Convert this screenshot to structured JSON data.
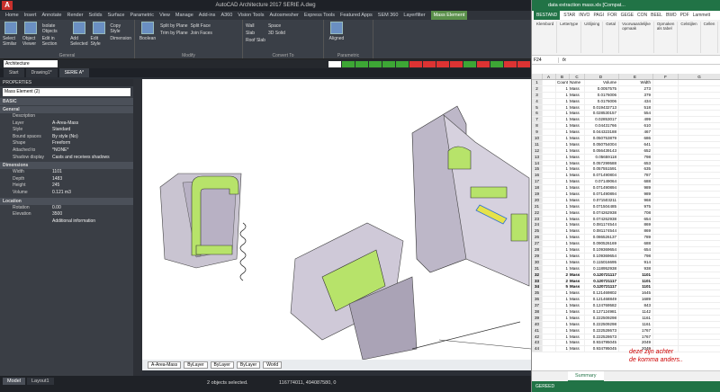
{
  "acad": {
    "title": "AutoCAD Architecture 2017   SERIE A.dwg",
    "logo": "A",
    "tabs": [
      "Home",
      "Insert",
      "Annotate",
      "Render",
      "Solids",
      "Surface",
      "Parametric",
      "View",
      "Manage",
      "Add-ins",
      "A360",
      "Vision Tools",
      "Autosmesher",
      "Express Tools",
      "Featured Apps",
      "SEM 360",
      "Layerfilter",
      "Mass Element"
    ],
    "active_tab": "Mass Element",
    "ribbon": {
      "general": {
        "name": "General",
        "select": "Select Similar",
        "viewer": "Object Viewer",
        "isolate": "Isolate Objects",
        "edit_section": "Edit in Section",
        "add_selected": "Add Selected",
        "edit_style": "Edit Style",
        "copy_style": "Copy Style",
        "dimension": "Dimension"
      },
      "modify": {
        "name": "Modify",
        "boolean": "Boolean",
        "split_plane": "Split by Plane",
        "trim_plane": "Trim by Plane",
        "split_face": "Split Face",
        "join_faces": "Join Faces"
      },
      "convert": {
        "name": "Convert To",
        "wall": "Wall",
        "slab": "Slab",
        "roof_slab": "Roof Slab",
        "space": "Space",
        "solid": "3D Solid"
      },
      "parametric": {
        "name": "Parametric",
        "aligned": "Aligned"
      }
    },
    "workspace": "Architecture",
    "file_tabs": [
      "Start",
      "Drawing1*",
      "SERIE A*"
    ],
    "current_file": "SERIE A*",
    "properties": {
      "header": "PROPERTIES",
      "selection": "Mass Element (2)",
      "sections": [
        "BASIC",
        "General",
        "Dimensions",
        "Location"
      ],
      "general_rows": [
        {
          "k": "Description",
          "v": ""
        },
        {
          "k": "Layer",
          "v": "A-Area-Mass"
        },
        {
          "k": "Style",
          "v": "Standard"
        },
        {
          "k": "Bound spaces",
          "v": "By style (No)"
        },
        {
          "k": "Shape",
          "v": "Freeform"
        },
        {
          "k": "Attached to",
          "v": "*NONE*"
        },
        {
          "k": "Shadow display",
          "v": "Casts and receives shadows"
        }
      ],
      "dim_rows": [
        {
          "k": "Width",
          "v": "1101"
        },
        {
          "k": "Depth",
          "v": "1483"
        },
        {
          "k": "Height",
          "v": "245"
        },
        {
          "k": "Volume",
          "v": "0.121 m3"
        }
      ],
      "loc_rows": [
        {
          "k": "Rotation",
          "v": "0.00"
        },
        {
          "k": "Elevation",
          "v": "3500"
        },
        {
          "k": "",
          "v": "Additional information"
        }
      ]
    },
    "side_tabs": [
      "Design",
      "Display",
      "Extended Data"
    ],
    "drawbar": {
      "layer": "A-Area-Mass",
      "color": "ByLayer",
      "linetype": "ByLayer",
      "lineweight": "ByLayer",
      "ucs": "World"
    },
    "bottom_tabs": [
      "Model",
      "Layout1"
    ],
    "status_msg": "2 objects selected.",
    "coords": "116774011, 494087580, 0"
  },
  "excel": {
    "title": "data extraction mass.xls [Compat...",
    "tabs": [
      "BESTAND",
      "STAR",
      "INVO",
      "PAGI",
      "FOR",
      "GEGE",
      "CON",
      "BEEL",
      "BWD",
      "PDF",
      "Lammett"
    ],
    "ribbon": [
      "Klembord",
      "Lettertype",
      "Uitlijning",
      "Getal",
      "Voorwaardelijke opmaak",
      "Opmaken als tabel",
      "Celstijlen",
      "Cellen",
      "Bewe"
    ],
    "ribbon_group": "Stijlen",
    "name_box": "F24",
    "fx": "fx",
    "columns": [
      "",
      "A",
      "B",
      "C",
      "D",
      "E",
      "F",
      "G"
    ],
    "headers": [
      "Count",
      "Name",
      "Volume",
      "Width"
    ],
    "rows": [
      [
        2,
        "1",
        "Mass",
        "0.0057575",
        "273"
      ],
      [
        3,
        "1",
        "Mass",
        "0.0176006",
        "379"
      ],
      [
        4,
        "1",
        "Mass",
        "0.0176006",
        "434"
      ],
      [
        5,
        "1",
        "Mass",
        "0.019432713",
        "518"
      ],
      [
        6,
        "1",
        "Mass",
        "0.028530157",
        "554"
      ],
      [
        7,
        "1",
        "Mass",
        "0.02853017",
        "499"
      ],
      [
        8,
        "1",
        "Mass",
        "0.04431766",
        "610"
      ],
      [
        9,
        "1",
        "Mass",
        "0.044323188",
        "467"
      ],
      [
        10,
        "1",
        "Mass",
        "0.050753879",
        "686"
      ],
      [
        11,
        "1",
        "Mass",
        "0.050754004",
        "641"
      ],
      [
        12,
        "1",
        "Mass",
        "0.056439143",
        "652"
      ],
      [
        13,
        "1",
        "Mass",
        "0.05659118",
        "798"
      ],
      [
        14,
        "1",
        "Mass",
        "0.057299588",
        "653"
      ],
      [
        15,
        "1",
        "Mass",
        "0.057551591",
        "635"
      ],
      [
        16,
        "1",
        "Mass",
        "0.071490804",
        "787"
      ],
      [
        17,
        "1",
        "Mass",
        "0.07149064",
        "688"
      ],
      [
        18,
        "1",
        "Mass",
        "0.071490894",
        "989"
      ],
      [
        19,
        "1",
        "Mass",
        "0.071490894",
        "989"
      ],
      [
        20,
        "1",
        "Mass",
        "0.071503211",
        "968"
      ],
      [
        21,
        "1",
        "Mass",
        "0.071504485",
        "975"
      ],
      [
        22,
        "1",
        "Mass",
        "0.074262938",
        "708"
      ],
      [
        23,
        "1",
        "Mass",
        "0.074262938",
        "654"
      ],
      [
        24,
        "1",
        "Mass",
        "0.081174544",
        "869"
      ],
      [
        25,
        "1",
        "Mass",
        "0.081174544",
        "869"
      ],
      [
        26,
        "1",
        "Mass",
        "0.086526137",
        "789"
      ],
      [
        27,
        "1",
        "Mass",
        "0.090526169",
        "688"
      ],
      [
        28,
        "1",
        "Mass",
        "0.109369654",
        "654"
      ],
      [
        29,
        "1",
        "Mass",
        "0.109369654",
        "798"
      ],
      [
        30,
        "1",
        "Mass",
        "0.115016695",
        "914"
      ],
      [
        31,
        "1",
        "Mass",
        "0.118952938",
        "938"
      ],
      [
        32,
        "2",
        "Mass",
        "0.120721117",
        "1101"
      ],
      [
        33,
        "2",
        "Mass",
        "0.120721117",
        "1101"
      ],
      [
        34,
        "5",
        "Mass",
        "0.120721117",
        "1101"
      ],
      [
        35,
        "1",
        "Mass",
        "0.121469802",
        "1645"
      ],
      [
        36,
        "1",
        "Mass",
        "0.121468849",
        "1689"
      ],
      [
        37,
        "1",
        "Mass",
        "0.124769582",
        "843"
      ],
      [
        38,
        "1",
        "Mass",
        "0.127124981",
        "1142"
      ],
      [
        39,
        "1",
        "Mass",
        "0.222509298",
        "1161"
      ],
      [
        40,
        "1",
        "Mass",
        "0.222509298",
        "1161"
      ],
      [
        41,
        "1",
        "Mass",
        "0.222528673",
        "1767"
      ],
      [
        42,
        "1",
        "Mass",
        "0.222528673",
        "1767"
      ],
      [
        43,
        "1",
        "Mass",
        "0.934795045",
        "2049"
      ],
      [
        44,
        "1",
        "Mass",
        "0.934795045",
        "2049"
      ]
    ],
    "bold_rows": [
      32,
      33,
      34
    ],
    "note_line1": "deze zijn achter",
    "note_line2": "de komma anders..",
    "sheet_tab": "Summary",
    "status": "GEREED"
  }
}
